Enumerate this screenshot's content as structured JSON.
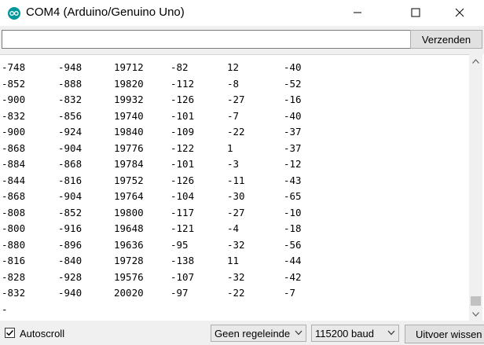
{
  "window": {
    "title": "COM4 (Arduino/Genuino Uno)",
    "icon": "arduino-logo-icon",
    "accent": "#00979c"
  },
  "send": {
    "value": "",
    "placeholder": "",
    "button_label": "Verzenden"
  },
  "output": {
    "rows": [
      [
        "-748",
        "-948",
        "19712",
        "-82",
        "12",
        "-40"
      ],
      [
        "-852",
        "-888",
        "19820",
        "-112",
        "-8",
        "-52"
      ],
      [
        "-900",
        "-832",
        "19932",
        "-126",
        "-27",
        "-16"
      ],
      [
        "-832",
        "-856",
        "19740",
        "-101",
        "-7",
        "-40"
      ],
      [
        "-900",
        "-924",
        "19840",
        "-109",
        "-22",
        "-37"
      ],
      [
        "-868",
        "-904",
        "19776",
        "-122",
        "1",
        "-37"
      ],
      [
        "-884",
        "-868",
        "19784",
        "-101",
        "-3",
        "-12"
      ],
      [
        "-844",
        "-816",
        "19752",
        "-126",
        "-11",
        "-43"
      ],
      [
        "-868",
        "-904",
        "19764",
        "-104",
        "-30",
        "-65"
      ],
      [
        "-808",
        "-852",
        "19800",
        "-117",
        "-27",
        "-10"
      ],
      [
        "-800",
        "-916",
        "19648",
        "-121",
        "-4",
        "-18"
      ],
      [
        "-880",
        "-896",
        "19636",
        "-95",
        "-32",
        "-56"
      ],
      [
        "-816",
        "-840",
        "19728",
        "-138",
        "11",
        "-44"
      ],
      [
        "-828",
        "-928",
        "19576",
        "-107",
        "-32",
        "-42"
      ],
      [
        "-832",
        "-940",
        "20020",
        "-97",
        "-22",
        "-7"
      ]
    ],
    "last_line": "-"
  },
  "footer": {
    "autoscroll_label": "Autoscroll",
    "autoscroll_checked": true,
    "line_ending": "Geen regeleinde",
    "baud": "115200 baud",
    "clear_label": "Uitvoer wissen"
  }
}
